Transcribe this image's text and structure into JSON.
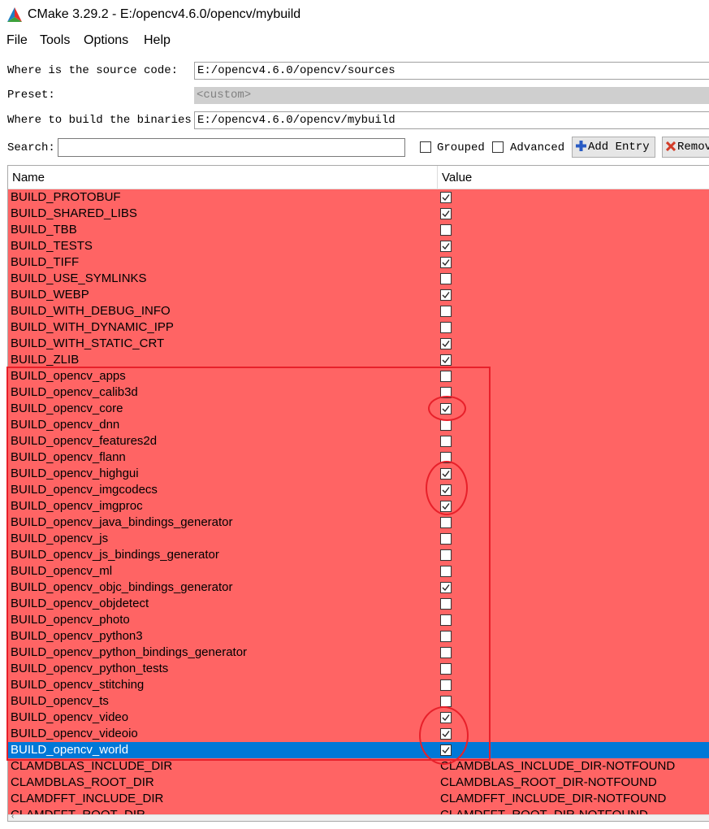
{
  "window": {
    "title": "CMake 3.29.2 - E:/opencv4.6.0/opencv/mybuild"
  },
  "menu": [
    "File",
    "Tools",
    "Options",
    "Help"
  ],
  "form": {
    "source_label": "Where is the source code:",
    "source_value": "E:/opencv4.6.0/opencv/sources",
    "preset_label": "Preset:",
    "preset_value": "<custom>",
    "binaries_label": "Where to build the binaries:",
    "binaries_value": "E:/opencv4.6.0/opencv/mybuild",
    "search_label": "Search:",
    "search_value": ""
  },
  "options": {
    "grouped_label": "Grouped",
    "advanced_label": "Advanced"
  },
  "buttons": {
    "add_entry": "Add Entry",
    "remove_entry": "Remov"
  },
  "colors": {
    "row_bg": "#ff6464",
    "selected_bg": "#0078d7",
    "annotation": "#e8202a"
  },
  "table": {
    "headers": {
      "name": "Name",
      "value": "Value"
    },
    "rows": [
      {
        "name": "BUILD_PROTOBUF",
        "checked": true
      },
      {
        "name": "BUILD_SHARED_LIBS",
        "checked": true
      },
      {
        "name": "BUILD_TBB",
        "checked": false
      },
      {
        "name": "BUILD_TESTS",
        "checked": true
      },
      {
        "name": "BUILD_TIFF",
        "checked": true
      },
      {
        "name": "BUILD_USE_SYMLINKS",
        "checked": false
      },
      {
        "name": "BUILD_WEBP",
        "checked": true
      },
      {
        "name": "BUILD_WITH_DEBUG_INFO",
        "checked": false
      },
      {
        "name": "BUILD_WITH_DYNAMIC_IPP",
        "checked": false
      },
      {
        "name": "BUILD_WITH_STATIC_CRT",
        "checked": true
      },
      {
        "name": "BUILD_ZLIB",
        "checked": true
      },
      {
        "name": "BUILD_opencv_apps",
        "checked": false
      },
      {
        "name": "BUILD_opencv_calib3d",
        "checked": false
      },
      {
        "name": "BUILD_opencv_core",
        "checked": true
      },
      {
        "name": "BUILD_opencv_dnn",
        "checked": false
      },
      {
        "name": "BUILD_opencv_features2d",
        "checked": false
      },
      {
        "name": "BUILD_opencv_flann",
        "checked": false
      },
      {
        "name": "BUILD_opencv_highgui",
        "checked": true
      },
      {
        "name": "BUILD_opencv_imgcodecs",
        "checked": true
      },
      {
        "name": "BUILD_opencv_imgproc",
        "checked": true
      },
      {
        "name": "BUILD_opencv_java_bindings_generator",
        "checked": false
      },
      {
        "name": "BUILD_opencv_js",
        "checked": false
      },
      {
        "name": "BUILD_opencv_js_bindings_generator",
        "checked": false
      },
      {
        "name": "BUILD_opencv_ml",
        "checked": false
      },
      {
        "name": "BUILD_opencv_objc_bindings_generator",
        "checked": true
      },
      {
        "name": "BUILD_opencv_objdetect",
        "checked": false
      },
      {
        "name": "BUILD_opencv_photo",
        "checked": false
      },
      {
        "name": "BUILD_opencv_python3",
        "checked": false
      },
      {
        "name": "BUILD_opencv_python_bindings_generator",
        "checked": false
      },
      {
        "name": "BUILD_opencv_python_tests",
        "checked": false
      },
      {
        "name": "BUILD_opencv_stitching",
        "checked": false
      },
      {
        "name": "BUILD_opencv_ts",
        "checked": false
      },
      {
        "name": "BUILD_opencv_video",
        "checked": true
      },
      {
        "name": "BUILD_opencv_videoio",
        "checked": true
      },
      {
        "name": "BUILD_opencv_world",
        "checked": true,
        "selected": true
      },
      {
        "name": "CLAMDBLAS_INCLUDE_DIR",
        "value": "CLAMDBLAS_INCLUDE_DIR-NOTFOUND"
      },
      {
        "name": "CLAMDBLAS_ROOT_DIR",
        "value": "CLAMDBLAS_ROOT_DIR-NOTFOUND"
      },
      {
        "name": "CLAMDFFT_INCLUDE_DIR",
        "value": "CLAMDFFT_INCLUDE_DIR-NOTFOUND"
      },
      {
        "name": "CLAMDFFT_ROOT_DIR",
        "value": "CLAMDFFT_ROOT_DIR-NOTFOUND"
      }
    ]
  }
}
